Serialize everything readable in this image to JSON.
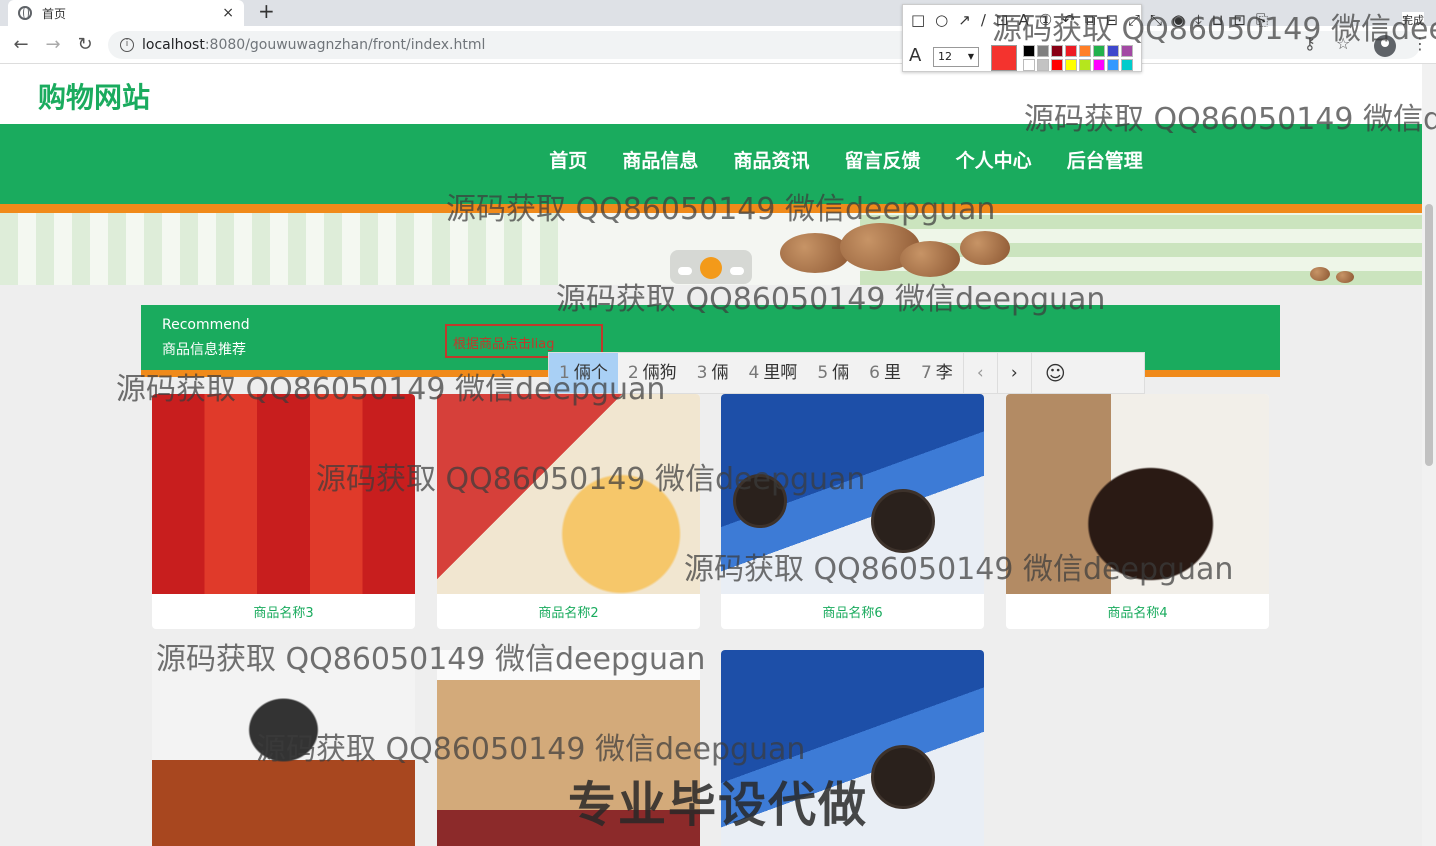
{
  "browser": {
    "tab_title": "首页",
    "tab_close": "×",
    "new_tab": "+",
    "url_host": "localhost",
    "url_path": ":8080/gouwuwagnzhan/front/index.html",
    "back": "←",
    "forward": "→",
    "reload": "↻",
    "key_icon": "⚷",
    "star_icon": "☆",
    "menu_icon": "⋮",
    "info_icon": "i"
  },
  "annotation_toolbar": {
    "tools": "□○↗∕⊡A①↶⧉⊟⤢⤡◉⤓⊔⊡⎘",
    "font_icon": "A",
    "font_size": "12",
    "current_color": "#f4332e",
    "palette": [
      "#000000",
      "#7f7f7f",
      "#880015",
      "#ed1c24",
      "#ff7f27",
      "#22b14c",
      "#3f48cc",
      "#a349a4",
      "#ffffff",
      "#c3c3c3",
      "#ff0000",
      "#ffff00",
      "#b5e61d",
      "#ff00ff",
      "#3399ff",
      "#00cccc"
    ],
    "done_label": "完成"
  },
  "site": {
    "logo": "购物网站",
    "nav": [
      "首页",
      "商品信息",
      "商品资讯",
      "留言反馈",
      "个人中心",
      "后台管理"
    ],
    "section_en": "Recommend",
    "section_cn": "商品信息推荐",
    "search_value": "根据商品点击liag"
  },
  "ime": {
    "candidates": [
      {
        "num": "1",
        "text": "倆个"
      },
      {
        "num": "2",
        "text": "倆狗"
      },
      {
        "num": "3",
        "text": "倆"
      },
      {
        "num": "4",
        "text": "里啊"
      },
      {
        "num": "5",
        "text": "倆"
      },
      {
        "num": "6",
        "text": "里"
      },
      {
        "num": "7",
        "text": "李"
      }
    ],
    "prev": "‹",
    "next": "›",
    "emoji": "☺"
  },
  "products": [
    {
      "name": "商品名称3",
      "image": "baijiu"
    },
    {
      "name": "商品名称2",
      "image": "scallop"
    },
    {
      "name": "商品名称6",
      "image": "oreo"
    },
    {
      "name": "商品名称4",
      "image": "jar"
    },
    {
      "name": "",
      "image": "snack"
    },
    {
      "name": "",
      "image": "box"
    },
    {
      "name": "",
      "image": "oreo"
    }
  ],
  "watermark": {
    "text": "源码获取 QQ86050149 微信deepguan",
    "text_cut1": "源码获取 QQ86050149 微信dee",
    "text_cut2": "源码获取 QQ86050149 微信de",
    "banner": "专业毕设代做"
  }
}
